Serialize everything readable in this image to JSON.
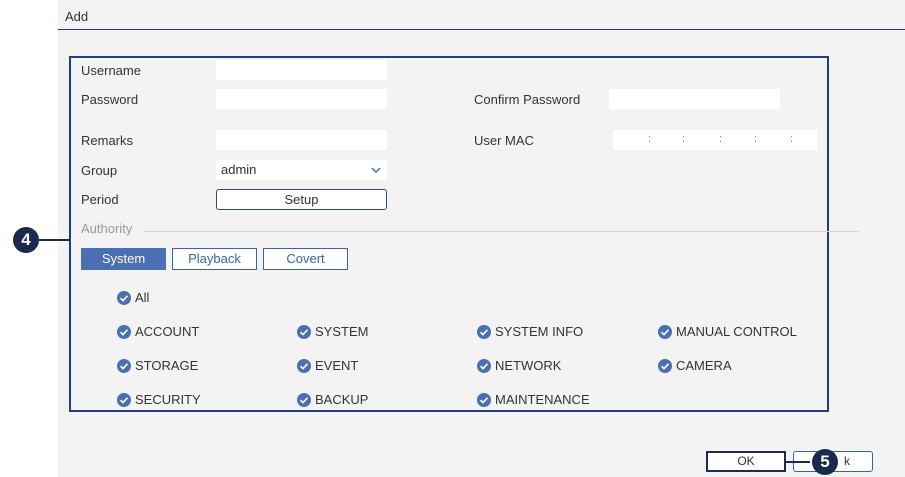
{
  "dialog": {
    "title": "Add"
  },
  "form": {
    "username_label": "Username",
    "password_label": "Password",
    "confirm_password_label": "Confirm Password",
    "remarks_label": "Remarks",
    "user_mac_label": "User MAC",
    "mac_separators": [
      ":",
      ":",
      ":",
      ":",
      ":"
    ],
    "group_label": "Group",
    "group_value": "admin",
    "period_label": "Period",
    "setup_label": "Setup"
  },
  "authority": {
    "label": "Authority",
    "tabs": [
      {
        "label": "System",
        "active": true
      },
      {
        "label": "Playback",
        "active": false
      },
      {
        "label": "Covert",
        "active": false
      }
    ],
    "all_label": "All",
    "permissions": [
      "ACCOUNT",
      "SYSTEM",
      "SYSTEM INFO",
      "MANUAL CONTROL",
      "STORAGE",
      "EVENT",
      "NETWORK",
      "CAMERA",
      "SECURITY",
      "BACKUP",
      "MAINTENANCE"
    ]
  },
  "footer": {
    "ok_label": "OK",
    "cancel_label": "k"
  },
  "callouts": {
    "four": "4",
    "five": "5"
  },
  "colors": {
    "accent": "#4a6fb3",
    "outline": "#1f3e86",
    "callout": "#1a2a4f",
    "check": "#4a6fb3"
  }
}
